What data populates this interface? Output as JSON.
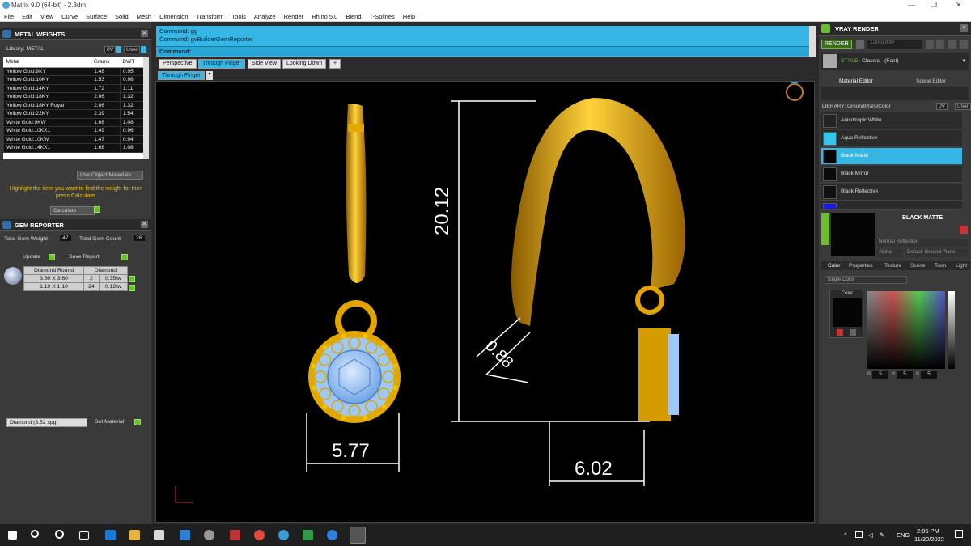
{
  "window": {
    "title": "Matrix 9.0 (64-bit) - 2.3dm",
    "controls": [
      "—",
      "❐",
      "✕"
    ]
  },
  "menu": [
    "File",
    "Edit",
    "View",
    "Curve",
    "Surface",
    "Solid",
    "Mesh",
    "Dimension",
    "Transform",
    "Tools",
    "Analyze",
    "Render",
    "Rhino 5.0",
    "Blend",
    "T-Splines",
    "Help"
  ],
  "metal_weights": {
    "title": "METAL WEIGHTS",
    "library_label": "Library: METAL",
    "tag_0v": "0V",
    "tag_user": "User",
    "columns": [
      "Metal",
      "Grams",
      "DWT"
    ],
    "rows": [
      [
        "Yellow Gold:9KY",
        "1.48",
        "0.95"
      ],
      [
        "Yellow Gold:10KY",
        "1.53",
        "0.98"
      ],
      [
        "Yellow Gold:14KY",
        "1.72",
        "1.11"
      ],
      [
        "Yellow Gold:18KY",
        "2.06",
        "1.32"
      ],
      [
        "Yellow Gold:18KY Royal",
        "2.06",
        "1.32"
      ],
      [
        "Yellow Gold:22KY",
        "2.39",
        "1.54"
      ],
      [
        "White Gold:9KW",
        "1.68",
        "1.08"
      ],
      [
        "White Gold:10KX1",
        "1.49",
        "0.96"
      ],
      [
        "White Gold:10KW",
        "1.47",
        "0.94"
      ],
      [
        "White Gold:14KX1",
        "1.68",
        "1.08"
      ]
    ],
    "use_object_materials": "Use Object Materials",
    "hint": "Highlight the item you want to find the weight for then press Calculate.",
    "calculate_label": "Calculate"
  },
  "gem_reporter": {
    "title": "GEM REPORTER",
    "total_weight_label": "Total Gem Weight",
    "total_weight_value": "47",
    "total_count_label": "Total Gem Count",
    "total_count_value": "26",
    "update_label": "Update",
    "save_report_label": "Save Report",
    "group_name": "Diamond Round",
    "group_type": "Diamond",
    "rows": [
      [
        "3.60 X 3.60",
        "2",
        "0.35tw"
      ],
      [
        "1.10 X 1.10",
        "24",
        "0.12tw"
      ]
    ],
    "material_select": "Diamond    (3.52 spg)",
    "set_material_label": "Set Material"
  },
  "command": {
    "line1": "Command: gg",
    "line2": "Command: gvBuilderGemReporter",
    "prompt": "Command:"
  },
  "view_tabs": [
    "Perspective",
    "Through Finger",
    "Side View",
    "Looking Down"
  ],
  "active_tab": "Through Finger",
  "viewport_label": "Through Finger",
  "dimensions": {
    "height": "20.12",
    "wire": "0.88",
    "width_left": "5.77",
    "width_right": "6.02"
  },
  "vray": {
    "title": "VRAY RENDER",
    "render_label": "RENDER",
    "resolution": "1200x900",
    "style_label": "STYLE:",
    "style_value": "Classic - (Fast)",
    "tabs": [
      "Material Editor",
      "Scene Editor"
    ],
    "library_label": "LIBRARY: GroundPlaneColor",
    "materials": [
      "Anisotropic White",
      "Aqua Reflective",
      "Black Matte",
      "Black Mirror",
      "Black Reflective"
    ],
    "selected_material": "Black Matte",
    "preview_title": "BLACK MATTE",
    "reflection": "Normal Reflection",
    "alpha": "Alpha",
    "ground": "Default Ground Plane",
    "prop_tabs": [
      "Color",
      "Properties",
      "Texture",
      "Scene",
      "Toon",
      "Light"
    ],
    "color_mode": "Single Color",
    "color_label": "Color",
    "rgb": [
      "5",
      "5",
      "5"
    ],
    "rgb_labels": [
      "R",
      "G",
      "B"
    ]
  },
  "taskbar": {
    "lang": "ENG",
    "time": "2:06 PM",
    "date": "11/30/2022"
  },
  "colors": {
    "accent": "#35b6e4",
    "gold": "#f2b600",
    "gem": "#9ec8f5",
    "green": "#6bbf2e"
  }
}
